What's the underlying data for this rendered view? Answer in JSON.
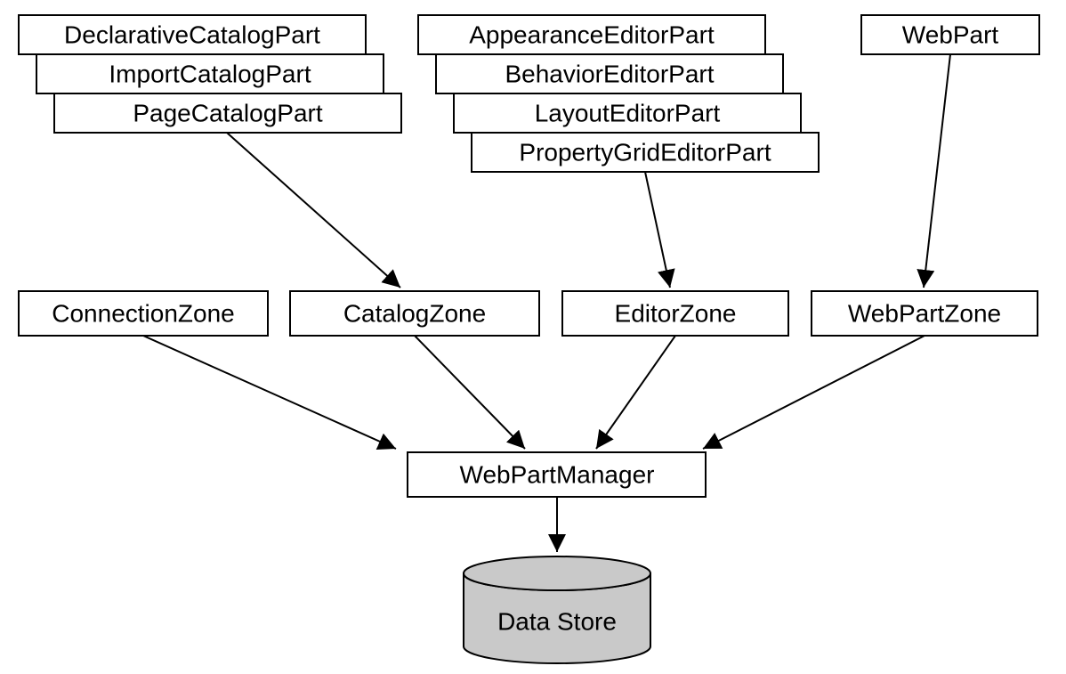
{
  "catalog_parts": {
    "a": "DeclarativeCatalogPart",
    "b": "ImportCatalogPart",
    "c": "PageCatalogPart"
  },
  "editor_parts": {
    "a": "AppearanceEditorPart",
    "b": "BehaviorEditorPart",
    "c": "LayoutEditorPart",
    "d": "PropertyGridEditorPart"
  },
  "web_part": "WebPart",
  "zones": {
    "connection": "ConnectionZone",
    "catalog": "CatalogZone",
    "editor": "EditorZone",
    "webpart": "WebPartZone"
  },
  "manager": "WebPartManager",
  "datastore": "Data Store"
}
